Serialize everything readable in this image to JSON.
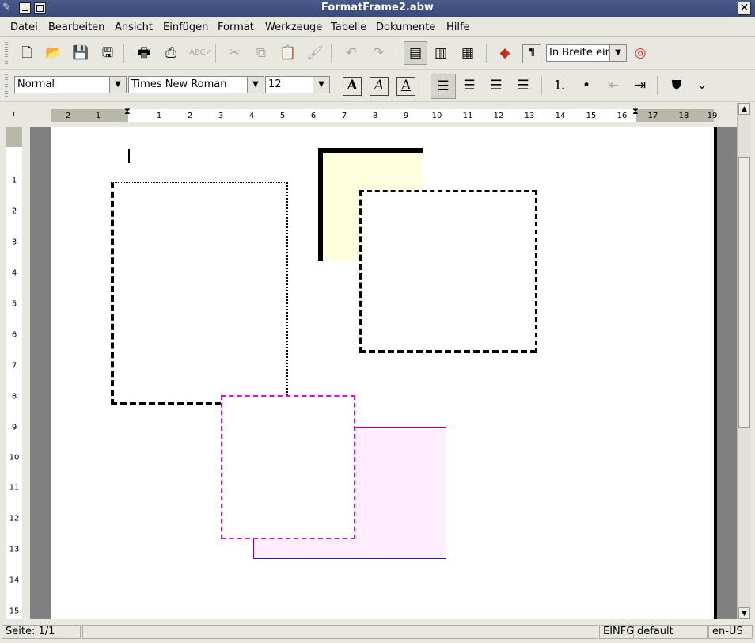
{
  "window": {
    "title": "FormatFrame2.abw"
  },
  "menubar": [
    "Datei",
    "Bearbeiten",
    "Ansicht",
    "Einfügen",
    "Format",
    "Werkzeuge",
    "Tabelle",
    "Dokumente",
    "Hilfe"
  ],
  "toolbar1": {
    "zoom_value": "In Breite ein",
    "icons": [
      "new-document-icon",
      "open-folder-icon",
      "save-icon",
      "save-as-icon",
      "print-icon",
      "print-preview-icon",
      "spellcheck-icon",
      "cut-icon",
      "copy-icon",
      "paste-icon",
      "format-painter-icon",
      "undo-icon",
      "redo-icon",
      "layout-normal-icon",
      "layout-web-icon",
      "layout-print-icon",
      "insert-shapes-icon",
      "show-formatting-icon",
      "help-icon"
    ]
  },
  "toolbar2": {
    "style_value": "Normal",
    "font_value": "Times New Roman",
    "size_value": "12",
    "bold_label": "A",
    "italic_label": "A",
    "underline_label": "A"
  },
  "hruler": {
    "ticks": [
      "2",
      "1",
      "1",
      "2",
      "3",
      "4",
      "5",
      "6",
      "7",
      "8",
      "9",
      "10",
      "11",
      "12",
      "13",
      "14",
      "15",
      "16",
      "17",
      "18",
      "19"
    ]
  },
  "vruler": {
    "ticks": [
      "1",
      "2",
      "3",
      "4",
      "5",
      "6",
      "7",
      "8",
      "9",
      "10",
      "11",
      "12",
      "13",
      "14",
      "15"
    ]
  },
  "statusbar": {
    "page": "Seite: 1/1",
    "mode": "EINFG",
    "style": "default",
    "lang": "en-US"
  },
  "colors": {
    "yellow_frame": "#ffffe0",
    "pink_frame": "#ffeeff",
    "magenta_border": "#e000e0"
  }
}
